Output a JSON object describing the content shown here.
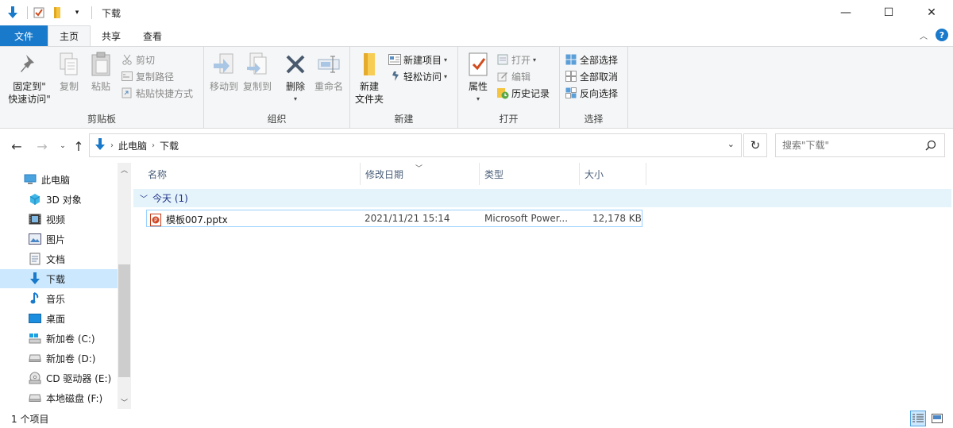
{
  "window": {
    "title": "下载",
    "minimize": "—",
    "maximize": "☐",
    "close": "✕"
  },
  "ribbon_tabs": [
    "文件",
    "主页",
    "共享",
    "查看"
  ],
  "ribbon": {
    "clipboard": {
      "pin_label_1": "固定到\"",
      "pin_label_2": "快速访问\"",
      "copy": "复制",
      "paste": "粘贴",
      "cut": "剪切",
      "copy_path": "复制路径",
      "paste_shortcut": "粘贴快捷方式",
      "group": "剪贴板"
    },
    "organize": {
      "move_to": "移动到",
      "copy_to": "复制到",
      "delete": "删除",
      "rename": "重命名",
      "group": "组织"
    },
    "new": {
      "new_item": "新建项目",
      "easy_access": "轻松访问",
      "new_folder_1": "新建",
      "new_folder_2": "文件夹",
      "group": "新建"
    },
    "open": {
      "properties": "属性",
      "open": "打开",
      "edit": "编辑",
      "history": "历史记录",
      "group": "打开"
    },
    "select": {
      "select_all": "全部选择",
      "select_none": "全部取消",
      "invert": "反向选择",
      "group": "选择"
    }
  },
  "address": {
    "crumbs": [
      "此电脑",
      "下载"
    ],
    "search_placeholder": "搜索\"下载\""
  },
  "nav_pane": {
    "items": [
      {
        "label": "此电脑",
        "icon": "computer-icon"
      },
      {
        "label": "3D 对象",
        "icon": "3d-objects-icon"
      },
      {
        "label": "视频",
        "icon": "video-icon"
      },
      {
        "label": "图片",
        "icon": "pictures-icon"
      },
      {
        "label": "文档",
        "icon": "documents-icon"
      },
      {
        "label": "下载",
        "icon": "download-icon",
        "selected": true
      },
      {
        "label": "音乐",
        "icon": "music-icon"
      },
      {
        "label": "桌面",
        "icon": "desktop-icon"
      },
      {
        "label": "新加卷 (C:)",
        "icon": "drive-c-icon"
      },
      {
        "label": "新加卷 (D:)",
        "icon": "drive-icon"
      },
      {
        "label": "CD 驱动器 (E:)",
        "icon": "cd-drive-icon"
      },
      {
        "label": "本地磁盘 (F:)",
        "icon": "drive-icon"
      }
    ]
  },
  "columns": [
    "名称",
    "修改日期",
    "类型",
    "大小"
  ],
  "group": {
    "label": "今天 (1)"
  },
  "files": [
    {
      "name": "模板007.pptx",
      "date": "2021/11/21 15:14",
      "type": "Microsoft Power...",
      "size": "12,178 KB",
      "icon": "pptx-file-icon"
    }
  ],
  "status": {
    "count": "1 个项目"
  },
  "colors": {
    "accent": "#1979ca",
    "selected": "#cce8ff",
    "group_header": "#e5f3fb"
  }
}
